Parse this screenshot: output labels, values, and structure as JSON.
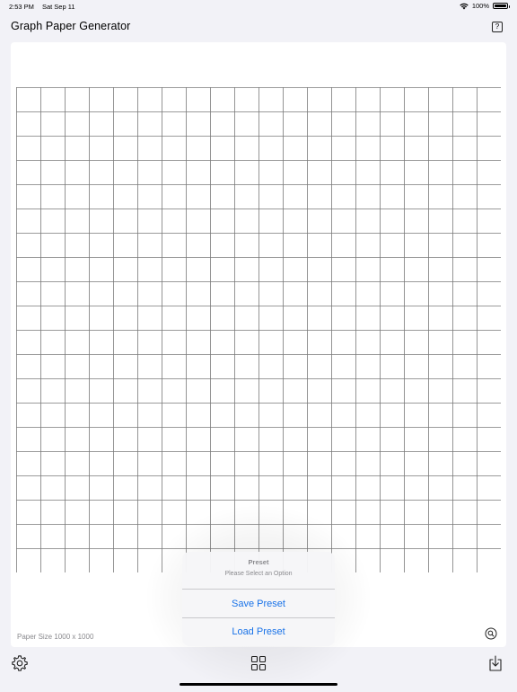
{
  "status_bar": {
    "time": "2:53 PM",
    "date": "Sat Sep 11",
    "battery": "100%",
    "icons": [
      "wifi-icon",
      "battery-icon"
    ]
  },
  "header": {
    "title": "Graph Paper Generator",
    "help_label": "?"
  },
  "paper": {
    "size_label": "Paper Size 1000 x 1000",
    "grid": {
      "columns": 20,
      "rows": 20,
      "line_color": "#7a7a7a"
    }
  },
  "popover": {
    "title": "Preset",
    "message": "Please Select an Option",
    "actions": [
      {
        "label": "Save Preset"
      },
      {
        "label": "Load Preset"
      }
    ]
  },
  "toolbar": {
    "icons": [
      "gear-icon",
      "grid-icon",
      "download-icon"
    ]
  },
  "colors": {
    "accent": "#1a73e8",
    "background": "#f2f2f7",
    "paper": "#ffffff"
  }
}
